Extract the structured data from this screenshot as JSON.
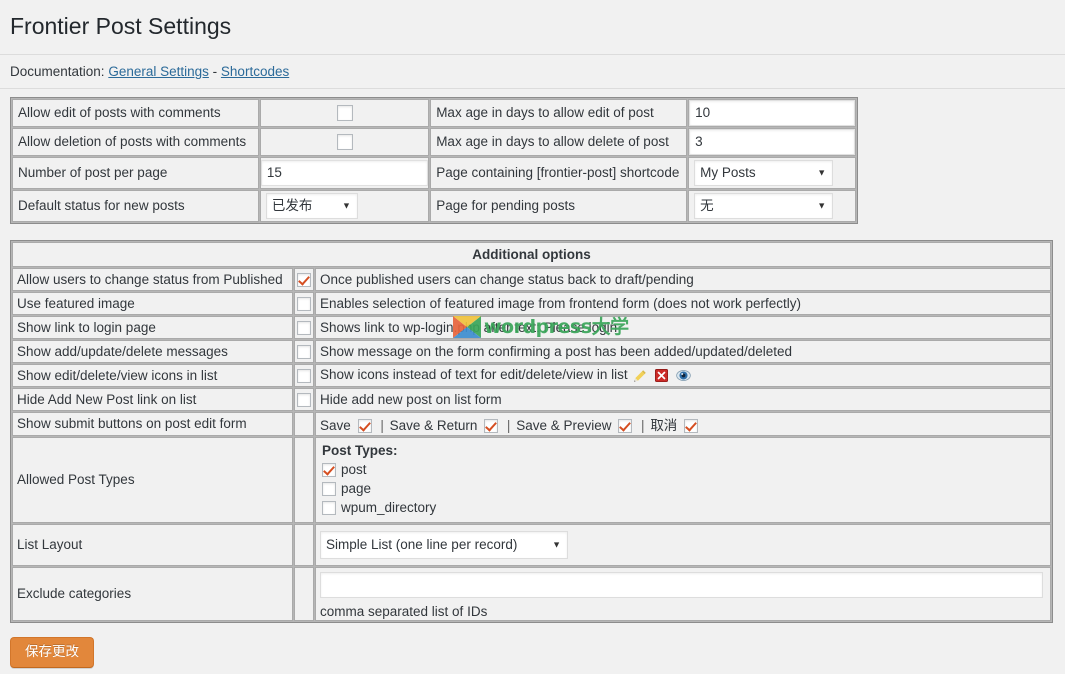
{
  "page": {
    "title": "Frontier Post Settings",
    "background_color": "#f1f1f1",
    "accent_color": "#d54e21"
  },
  "documentation": {
    "label": "Documentation:",
    "link_general": "General Settings",
    "separator": "-",
    "link_shortcodes": "Shortcodes"
  },
  "general_table": {
    "rows": [
      {
        "left_label": "Allow edit of posts with comments",
        "left_control": {
          "type": "checkbox",
          "checked": false
        },
        "right_label": "Max age in days to allow edit of post",
        "right_control": {
          "type": "text",
          "value": "10"
        }
      },
      {
        "left_label": "Allow deletion of posts with comments",
        "left_control": {
          "type": "checkbox",
          "checked": false
        },
        "right_label": "Max age in days to allow delete of post",
        "right_control": {
          "type": "text",
          "value": "3"
        }
      },
      {
        "left_label": "Number of post per page",
        "left_control": {
          "type": "text",
          "value": "15"
        },
        "right_label": "Page containing [frontier-post] shortcode",
        "right_control": {
          "type": "select",
          "value": "My Posts"
        }
      },
      {
        "left_label": "Default status for new posts",
        "left_control": {
          "type": "select",
          "value": "已发布"
        },
        "right_label": "Page for pending posts",
        "right_control": {
          "type": "select",
          "value": "无"
        }
      }
    ]
  },
  "additional_options": {
    "header": "Additional options",
    "rows": [
      {
        "option": "Allow users to change status from Published",
        "checked": true,
        "description": "Once published users can change status back to draft/pending"
      },
      {
        "option": "Use featured image",
        "checked": false,
        "description": "Enables selection of featured image from frontend form (does not work perfectly)"
      },
      {
        "option": "Show link to login page",
        "checked": false,
        "description": "Shows link to wp-login.php after text: Please login"
      },
      {
        "option": "Show add/update/delete messages",
        "checked": false,
        "description": "Show message on the form confirming a post has been added/updated/deleted"
      },
      {
        "option": "Show edit/delete/view icons in list",
        "checked": false,
        "description": "Show icons instead of text for edit/delete/view in list",
        "trailing_icons": [
          "pencil-icon",
          "delete-icon",
          "eye-icon"
        ]
      },
      {
        "option": "Hide Add New Post link on list",
        "checked": false,
        "description": "Hide add new post on list form"
      }
    ],
    "submit_buttons_row": {
      "option": "Show submit buttons on post edit form",
      "buttons": [
        {
          "label": "Save",
          "checked": true
        },
        {
          "label": "Save & Return",
          "checked": true
        },
        {
          "label": "Save & Preview",
          "checked": true
        },
        {
          "label": "取消",
          "checked": true
        }
      ],
      "separator": "|"
    },
    "allowed_post_types_row": {
      "option": "Allowed Post Types",
      "group_title": "Post Types:",
      "types": [
        {
          "label": "post",
          "checked": true
        },
        {
          "label": "page",
          "checked": false
        },
        {
          "label": "wpum_directory",
          "checked": false
        }
      ]
    },
    "list_layout_row": {
      "option": "List Layout",
      "value": "Simple List (one line per record)"
    },
    "exclude_categories_row": {
      "option": "Exclude categories",
      "value": "",
      "hint": "comma separated list of IDs"
    }
  },
  "footer": {
    "save_label": "保存更改"
  },
  "watermark": {
    "text_en": "wordpress",
    "text_cn": "大学"
  }
}
